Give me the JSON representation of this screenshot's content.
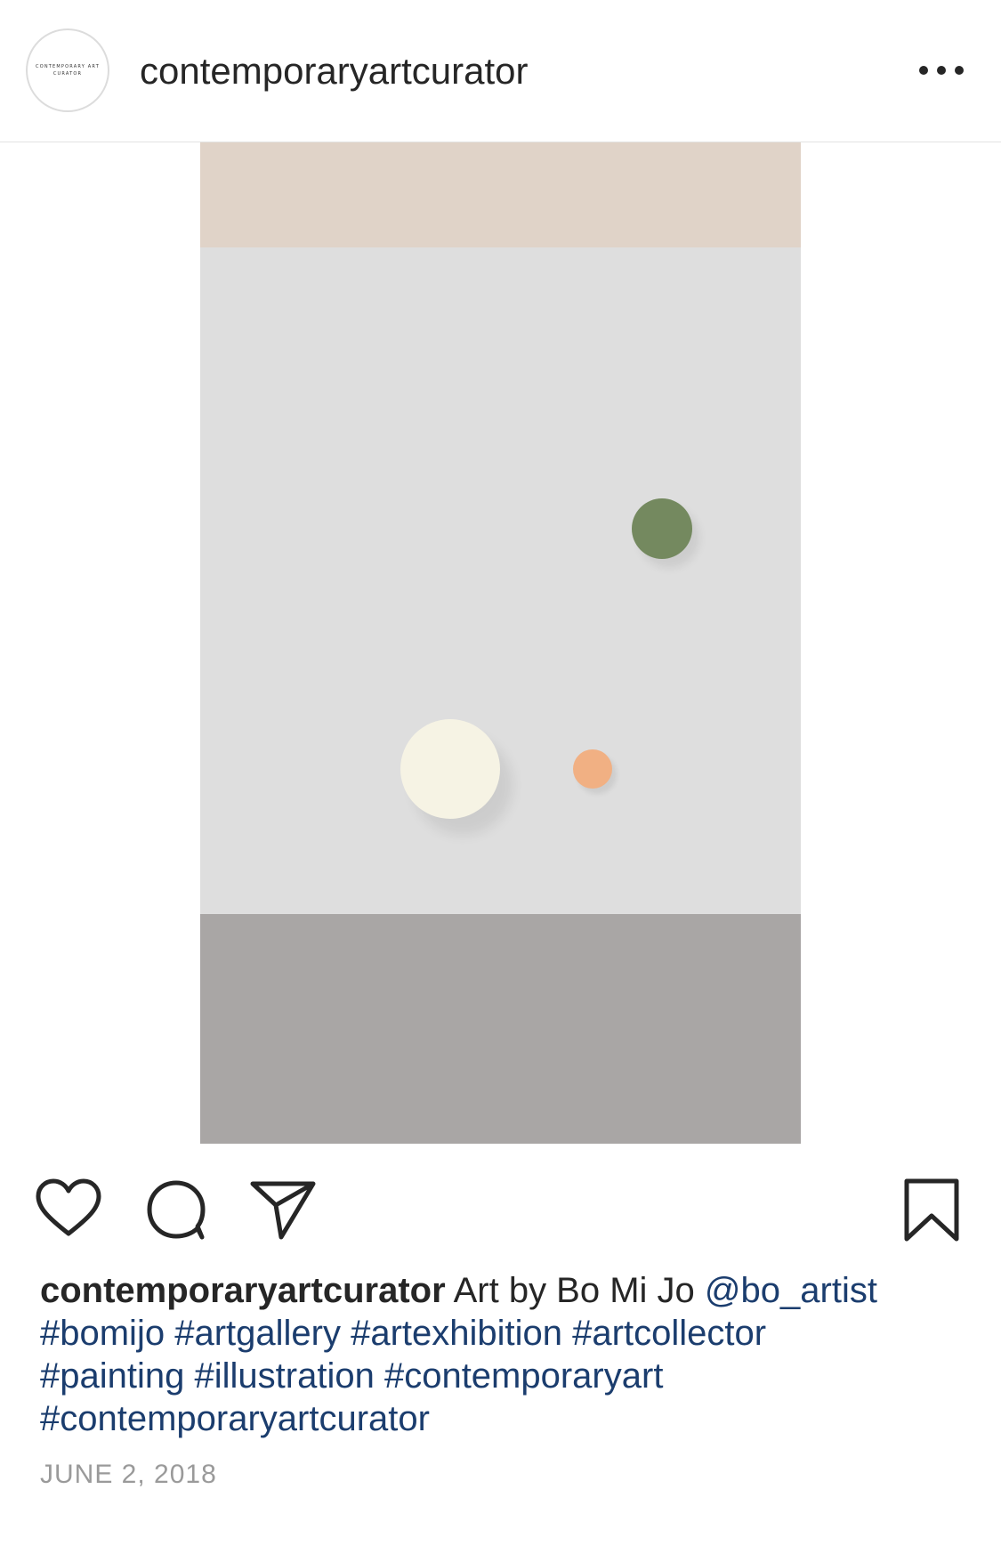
{
  "header": {
    "avatar_text_line1": "CONTEMPORARY ART",
    "avatar_text_line2": "CURATOR",
    "username": "contemporaryartcurator",
    "more_icon": "more-horizontal-icon"
  },
  "post_image": {
    "colors": {
      "top_band": "#e0d3c8",
      "middle_band": "#dedede",
      "bottom_band": "#a9a6a5",
      "green_ball": "#74895f",
      "cream_ball": "#f6f3e4",
      "orange_ball": "#f1b083"
    }
  },
  "actions": {
    "like_icon": "heart-icon",
    "comment_icon": "comment-icon",
    "share_icon": "send-icon",
    "save_icon": "bookmark-icon"
  },
  "caption": {
    "username": "contemporaryartcurator",
    "text": "Art by Bo Mi Jo",
    "mention": "@bo_artist",
    "hashtags": [
      "#bomijo",
      "#artgallery",
      "#artexhibition",
      "#artcollector",
      "#painting",
      "#illustration",
      "#contemporaryart",
      "#contemporaryartcurator"
    ]
  },
  "date": "JUNE 2, 2018"
}
